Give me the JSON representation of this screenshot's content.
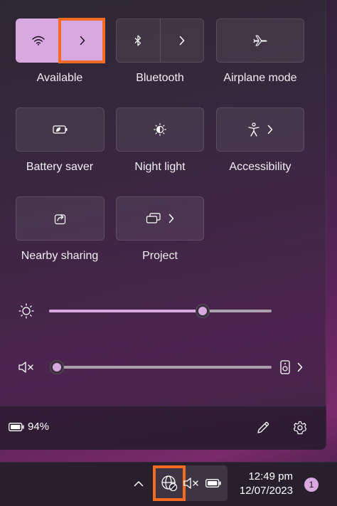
{
  "tiles": {
    "wifi": {
      "label": "Available",
      "icon": "wifi-icon",
      "active": true
    },
    "bluetooth": {
      "label": "Bluetooth",
      "icon": "bluetooth-icon"
    },
    "airplane": {
      "label": "Airplane mode",
      "icon": "airplane-icon"
    },
    "battery_saver": {
      "label": "Battery saver",
      "icon": "battery-saver-icon"
    },
    "night_light": {
      "label": "Night light",
      "icon": "night-light-icon"
    },
    "accessibility": {
      "label": "Accessibility",
      "icon": "accessibility-icon"
    },
    "nearby_sharing": {
      "label": "Nearby sharing",
      "icon": "share-icon"
    },
    "project": {
      "label": "Project",
      "icon": "project-icon"
    }
  },
  "sliders": {
    "brightness": {
      "icon": "brightness-icon",
      "level": 0.69
    },
    "volume": {
      "icon": "muted-speaker-icon",
      "level": 0.0,
      "output_icon": "speaker-device-icon"
    }
  },
  "footer": {
    "battery_percent": "94%",
    "battery_icon": "battery-icon",
    "edit_icon": "pencil-icon",
    "settings_icon": "gear-icon"
  },
  "taskbar": {
    "overflow_icon": "chevron-up-icon",
    "network_icon": "globe-no-internet-icon",
    "volume_icon": "muted-speaker-icon",
    "battery_icon": "battery-icon",
    "time": "12:49 pm",
    "date": "12/07/2023",
    "notification_count": "1"
  },
  "colors": {
    "accent": "#d8a8e0",
    "highlight": "#f36c21",
    "taskbar": "#271f2c"
  }
}
